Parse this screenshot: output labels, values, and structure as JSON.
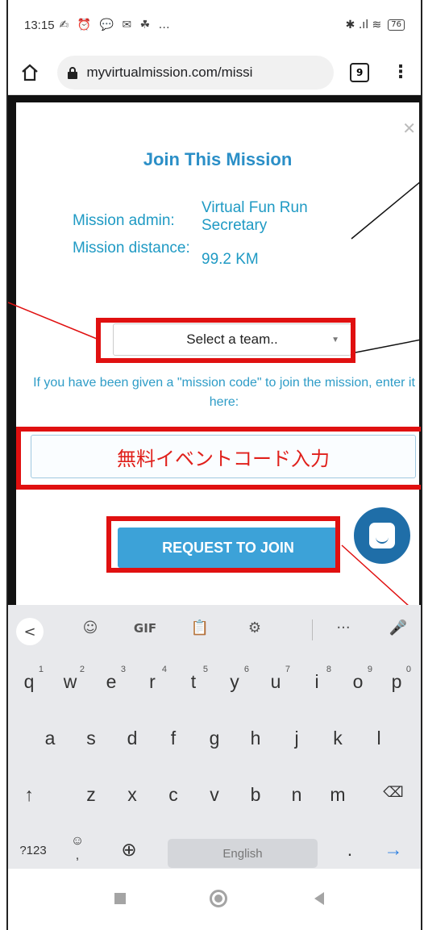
{
  "status_bar": {
    "time": "13:15",
    "icons": "✍ ⏰ 💬 ✉ ☘ …",
    "signal": "✱ .ıl ≋",
    "battery": "76"
  },
  "browser": {
    "url": "myvirtualmission.com/missi",
    "tab_count": "9"
  },
  "modal": {
    "title": "Join This Mission",
    "admin_label": "Mission admin:",
    "admin_value": "Virtual Fun Run Secretary",
    "distance_label": "Mission distance:",
    "distance_value": "99.2 KM",
    "team_select": "Select a team..",
    "hint": "If you have been given a \"mission code\" to join the mission, enter it here:",
    "code_overlay": "無料イベントコード入力",
    "join_button": "REQUEST TO JOIN"
  },
  "keyboard": {
    "toolbar": [
      "<",
      "☺",
      "GIF",
      "📋",
      "⚙",
      "···",
      "🎤"
    ],
    "row1": [
      "q",
      "w",
      "e",
      "r",
      "t",
      "y",
      "u",
      "i",
      "o",
      "p"
    ],
    "row1_hints": [
      "1",
      "2",
      "3",
      "4",
      "5",
      "6",
      "7",
      "8",
      "9",
      "0"
    ],
    "row2": [
      "a",
      "s",
      "d",
      "f",
      "g",
      "h",
      "j",
      "k",
      "l"
    ],
    "row3": [
      "↑",
      "z",
      "x",
      "c",
      "v",
      "b",
      "n",
      "m",
      "⌫"
    ],
    "row4_left": "?123",
    "row4_emoji": "☺",
    "row4_comma": ",",
    "row4_globe": "⊕",
    "space_label": "English",
    "row4_period": ".",
    "enter": "→"
  },
  "colors": {
    "accent": "#2b8fc7",
    "highlight": "#e01010",
    "button": "#3ca2d8"
  }
}
